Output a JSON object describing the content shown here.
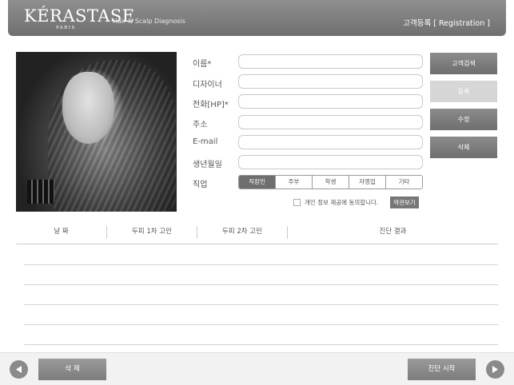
{
  "header": {
    "brand": "KÉRASTASE",
    "brand_sub": "PARIS",
    "app_name": "Hair & Scalp Diagnosis",
    "page_title": "고객등록  [ Registration ]"
  },
  "form": {
    "name_label": "이름*",
    "designer_label": "디자이너",
    "phone_label": "전화[HP]*",
    "address_label": "주소",
    "email_label": "E-mail",
    "birthday_label": "생년월일",
    "job_label": "직업",
    "name_value": "",
    "designer_value": "",
    "phone_value": "",
    "address_value": "",
    "email_value": "",
    "birthday_value": ""
  },
  "jobs": {
    "options": [
      "직장인",
      "주부",
      "학생",
      "자영업",
      "기타"
    ],
    "selected": "직장인"
  },
  "consent": {
    "text": "개인 정보 제공에 동의합니다.",
    "terms_button": "약관보기"
  },
  "actions": {
    "search": "고객검색",
    "register": "등록",
    "edit": "수정",
    "delete": "삭제"
  },
  "table": {
    "columns": [
      "날 짜",
      "두피 1차 고민",
      "두피 2차 고민",
      "진단 결과"
    ],
    "rows": []
  },
  "footer": {
    "delete_button": "삭 제",
    "start_button": "진단 시작"
  }
}
